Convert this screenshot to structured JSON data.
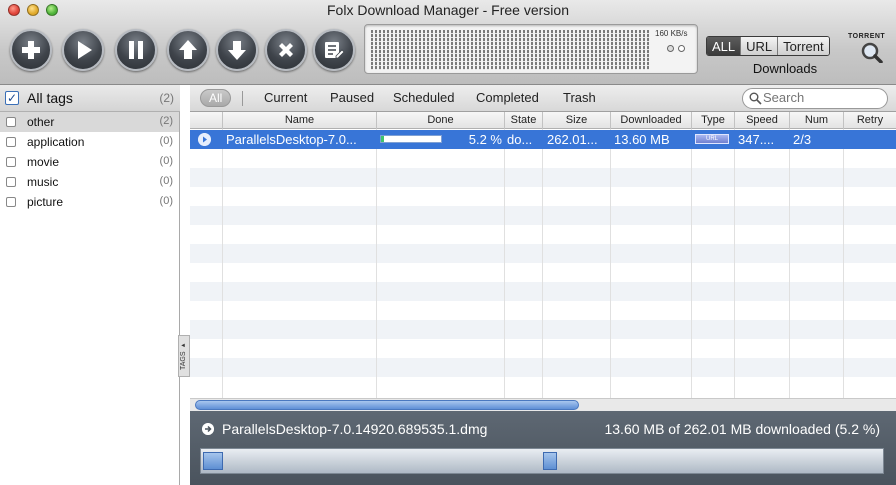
{
  "window": {
    "title": "Folx Download Manager - Free version"
  },
  "toolbar": {
    "speed_limit": "160 KB/s",
    "filter": [
      "ALL",
      "URL",
      "Torrent"
    ],
    "downloads_label": "Downloads",
    "torrent_label": "TORRENT"
  },
  "sidebar": {
    "all_tags": {
      "label": "All tags",
      "count": "(2)"
    },
    "toggle_label": "TAGS",
    "tags": [
      {
        "name": "other",
        "count": "(2)"
      },
      {
        "name": "application",
        "count": "(0)"
      },
      {
        "name": "movie",
        "count": "(0)"
      },
      {
        "name": "music",
        "count": "(0)"
      },
      {
        "name": "picture",
        "count": "(0)"
      }
    ]
  },
  "tabs": {
    "all": "All",
    "items": [
      "Current",
      "Paused",
      "Scheduled",
      "Completed",
      "Trash"
    ],
    "search_placeholder": "Search"
  },
  "table": {
    "columns": [
      "Name",
      "Done",
      "State",
      "Size",
      "Downloaded",
      "Type",
      "Speed",
      "Num",
      "Retry"
    ],
    "rows": [
      {
        "name": "ParallelsDesktop-7.0...",
        "done": "5.2 %",
        "done_fraction": 0.052,
        "state": "do...",
        "size": "262.01...",
        "downloaded": "13.60 MB",
        "type": "URL",
        "speed": "347....",
        "num": "2/3",
        "retry": ""
      }
    ]
  },
  "details": {
    "filename": "ParallelsDesktop-7.0.14920.689535.1.dmg",
    "status": "13.60 MB of 262.01 MB downloaded (5.2 %)"
  },
  "colors": {
    "selection": "#3875d7",
    "progress": "#3ec46d"
  }
}
